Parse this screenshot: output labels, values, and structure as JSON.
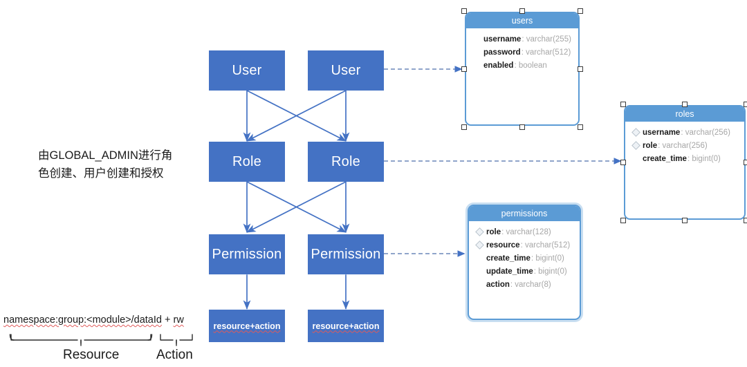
{
  "diagram": {
    "note_cn": "由GLOBAL_ADMIN进行角\n色创建、用户创建和授权",
    "colors": {
      "flow_box_fill": "#4472C4",
      "table_header_fill": "#5B9BD5",
      "table_border": "#5B9BD5",
      "connector": "#4472C4",
      "field_name": "#1a1a1a",
      "field_type": "#a6a6a6"
    },
    "flow_nodes": [
      {
        "id": "user-left",
        "label": "User"
      },
      {
        "id": "user-right",
        "label": "User"
      },
      {
        "id": "role-left",
        "label": "Role"
      },
      {
        "id": "role-right",
        "label": "Role"
      },
      {
        "id": "permission-left",
        "label": "Permission"
      },
      {
        "id": "permission-right",
        "label": "Permission"
      },
      {
        "id": "resaction-left",
        "label": "resource+action"
      },
      {
        "id": "resaction-right",
        "label": "resource+action"
      }
    ],
    "tables": [
      {
        "id": "users",
        "name": "users",
        "selected": true,
        "fields": [
          {
            "name": "username",
            "type": "varchar(255)",
            "key": false
          },
          {
            "name": "password",
            "type": "varchar(512)",
            "key": false
          },
          {
            "name": "enabled",
            "type": "boolean",
            "key": false
          }
        ]
      },
      {
        "id": "roles",
        "name": "roles",
        "selected": true,
        "fields": [
          {
            "name": "username",
            "type": "varchar(256)",
            "key": true
          },
          {
            "name": "role",
            "type": "varchar(256)",
            "key": true
          },
          {
            "name": "create_time",
            "type": "bigint(0)",
            "key": false
          }
        ]
      },
      {
        "id": "permissions",
        "name": "permissions",
        "selected": false,
        "fields": [
          {
            "name": "role",
            "type": "varchar(128)",
            "key": true
          },
          {
            "name": "resource",
            "type": "varchar(512)",
            "key": true
          },
          {
            "name": "create_time",
            "type": "bigint(0)",
            "key": false
          },
          {
            "name": "update_time",
            "type": "bigint(0)",
            "key": false
          },
          {
            "name": "action",
            "type": "varchar(8)",
            "key": false
          }
        ]
      }
    ],
    "annotation": {
      "expression_resource": "namespace:group:<module>/dataId",
      "expression_plus": " + ",
      "expression_action": "rw",
      "brace_resource_label": "Resource",
      "brace_action_label": "Action"
    }
  }
}
